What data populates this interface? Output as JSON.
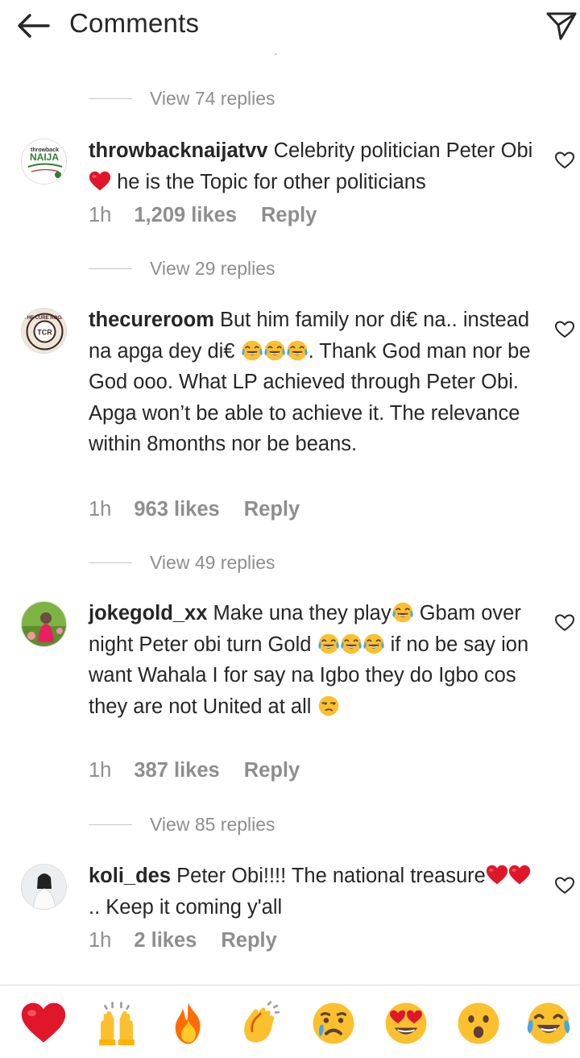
{
  "header": {
    "title": "Comments",
    "back_icon": "arrow-left-icon",
    "share_icon": "paper-plane-icon"
  },
  "top_replies": {
    "label": "View 74 replies"
  },
  "comments": [
    {
      "username": "throwbacknaijatvv",
      "time": "1h",
      "likes": "1,209 likes",
      "reply": "Reply",
      "view_replies": "View 29 replies",
      "parts": [
        "Celebrity politician Peter Obi ",
        " he is the Topic for other politicians"
      ],
      "emoji": [
        "red-heart"
      ]
    },
    {
      "username": "thecureroom",
      "time": "1h",
      "likes": "963 likes",
      "reply": "Reply",
      "view_replies": "View 49 replies",
      "parts": [
        "But him family nor di€ na.. instead na apga dey di€ ",
        ". Thank God man nor be God ooo. What LP achieved through Peter Obi. Apga won’t be able to achieve it. The relevance within 8months nor be beans."
      ],
      "emoji": [
        "tears-of-joy",
        "tears-of-joy",
        "tears-of-joy"
      ]
    },
    {
      "username": "jokegold_xx",
      "time": "1h",
      "likes": "387 likes",
      "reply": "Reply",
      "view_replies": "View 85 replies",
      "parts": [
        "Make una they play",
        " Gbam over night Peter obi turn Gold ",
        " if no be say ion want Wahala I for say na Igbo they do Igbo cos they are not United at all "
      ],
      "emoji": [
        "tears-of-joy",
        "tears-of-joy",
        "tears-of-joy",
        "tears-of-joy",
        "unamused-face"
      ]
    },
    {
      "username": "koli_des",
      "time": "1h",
      "likes": "2 likes",
      "reply": "Reply",
      "parts": [
        "Peter Obi!!!! The national treasure",
        ".. Keep it coming y'all"
      ],
      "emoji": [
        "red-heart",
        "red-heart"
      ]
    }
  ],
  "avatars": {
    "throwback_top": "throwback",
    "throwback_brand": "NAIJA",
    "cureroom_ring": "THE CURE ROOM",
    "cureroom_mono": "TCR"
  },
  "reactions": [
    "red-heart",
    "raising-hands",
    "fire",
    "clapping-hands",
    "crying-face",
    "heart-eyes",
    "surprised-face",
    "tears-of-joy"
  ],
  "colors": {
    "text": "#262626",
    "muted": "#8e8e8e",
    "heart_red": "#e0162b",
    "emoji_yellow": "#fbc02d"
  }
}
